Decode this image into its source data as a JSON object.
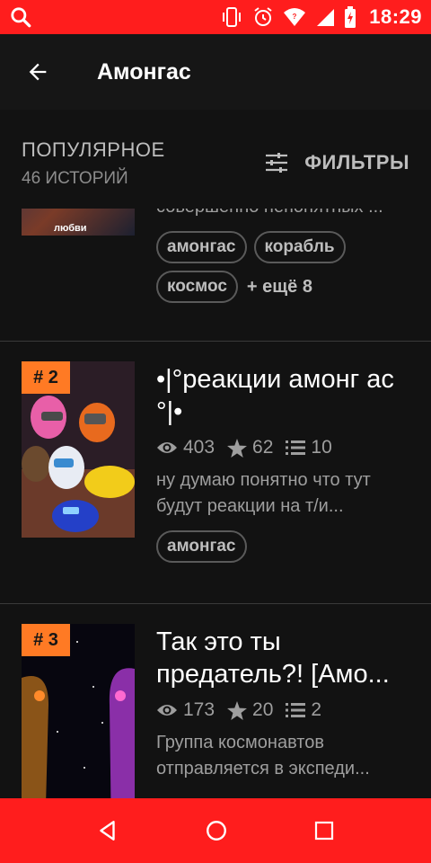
{
  "status_bar": {
    "time": "18:29"
  },
  "app_bar": {
    "title": "Амонгас"
  },
  "section": {
    "title": "ПОПУЛЯРНОЕ",
    "subtitle": "46 ИСТОРИЙ",
    "filters_label": "ФИЛЬТРЫ"
  },
  "stories": [
    {
      "rank": "",
      "title": "",
      "views": "",
      "likes": "",
      "parts": "",
      "description": "совершенно непонятных ...",
      "cover_text": "любви",
      "tags": [
        "амонгас",
        "корабль",
        "космос"
      ],
      "more_tags": "+ ещё 8"
    },
    {
      "rank": "# 2",
      "title": "•|°реакции амонг ас °|•",
      "views": "403",
      "likes": "62",
      "parts": "10",
      "description": "ну думаю понятно что тут будут реакции на т/и...",
      "tags": [
        "амонгас"
      ]
    },
    {
      "rank": "# 3",
      "title": "Так это ты предатель?! [Амо...",
      "views": "173",
      "likes": "20",
      "parts": "2",
      "description": "Группа космонавтов отправляется в экспеди...",
      "tags": []
    }
  ],
  "colors": {
    "status_bar": "#ff1d1d",
    "badge": "#ff7a24",
    "background": "#121212"
  }
}
